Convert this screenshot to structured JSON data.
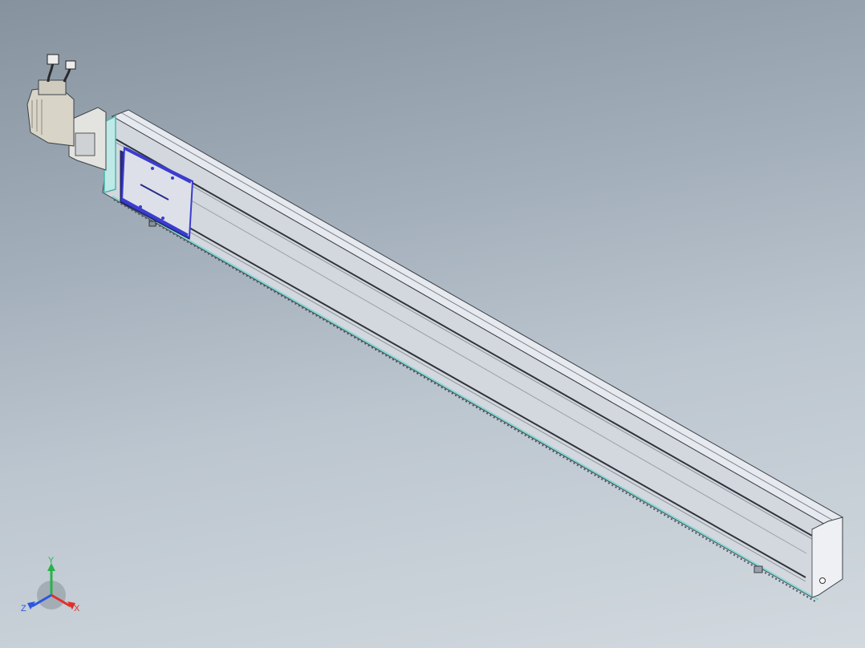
{
  "viewport": {
    "background_top": "#86939f",
    "background_bottom": "#d2d9df"
  },
  "model": {
    "rail_color": "#d9dde3",
    "rail_edge": "#3c4048",
    "accent_cyan": "#7fd6d2",
    "carriage_blue": "#3b3ccf",
    "motor_color": "#d8d4c8"
  },
  "triad": {
    "x_label": "X",
    "y_label": "Y",
    "z_label": "Z",
    "x_color": "#e0302a",
    "y_color": "#28b24a",
    "z_color": "#2c55e0"
  }
}
